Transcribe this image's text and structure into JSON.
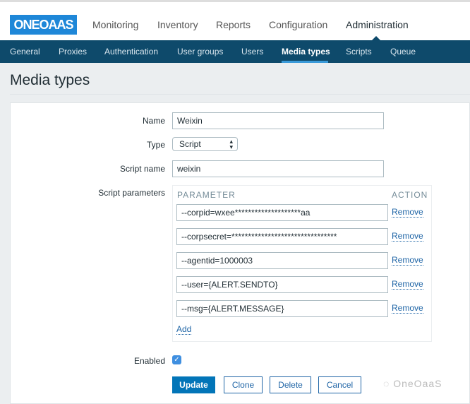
{
  "header": {
    "logo": "ONEOAAS",
    "menu": [
      "Monitoring",
      "Inventory",
      "Reports",
      "Configuration",
      "Administration"
    ],
    "active_menu": "Administration"
  },
  "subnav": {
    "items": [
      "General",
      "Proxies",
      "Authentication",
      "User groups",
      "Users",
      "Media types",
      "Scripts",
      "Queue"
    ],
    "active": "Media types"
  },
  "page_title": "Media types",
  "form": {
    "name_label": "Name",
    "name_value": "Weixin",
    "type_label": "Type",
    "type_value": "Script",
    "script_name_label": "Script name",
    "script_name_value": "weixin",
    "script_params_label": "Script parameters",
    "param_header": "PARAMETER",
    "action_header": "ACTION",
    "params": [
      "--corpid=wxee********************aa",
      "--corpsecret=********************************",
      "--agentid=1000003",
      "--user={ALERT.SENDTO}",
      "--msg={ALERT.MESSAGE}"
    ],
    "remove_label": "Remove",
    "add_label": "Add",
    "enabled_label": "Enabled",
    "enabled": true
  },
  "buttons": {
    "update": "Update",
    "clone": "Clone",
    "delete": "Delete",
    "cancel": "Cancel"
  },
  "watermark": "OneOaaS",
  "colors": {
    "nav": "#0e4a6b",
    "primary": "#0275b8",
    "logo": "#1e87d8"
  }
}
